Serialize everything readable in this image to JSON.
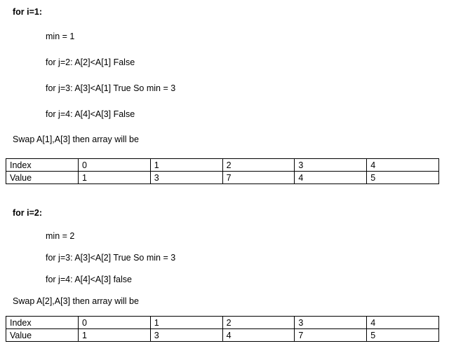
{
  "pass1": {
    "heading": "for i=1:",
    "min_line": "min = 1",
    "j_lines": [
      "for j=2:  A[2]<A[1] False",
      "for j=3:  A[3]<A[1] True So min = 3",
      "for j=4:  A[4]<A[3] False"
    ],
    "swap_line": "Swap A[1],A[3] then array will be",
    "table": {
      "index_label": "Index",
      "value_label": "Value",
      "indices": [
        "0",
        "1",
        "2",
        "3",
        "4"
      ],
      "values": [
        "1",
        "3",
        "7",
        "4",
        "5"
      ]
    }
  },
  "pass2": {
    "heading": "for i=2:",
    "min_line": "min = 2",
    "j_lines": [
      "for j=3:  A[3]<A[2] True So min = 3",
      "for j=4:  A[4]<A[3] false"
    ],
    "swap_line": "Swap A[2],A[3] then array will be",
    "table": {
      "index_label": "Index",
      "value_label": "Value",
      "indices": [
        "0",
        "1",
        "2",
        "3",
        "4"
      ],
      "values": [
        "1",
        "3",
        "4",
        "7",
        "5"
      ]
    }
  }
}
